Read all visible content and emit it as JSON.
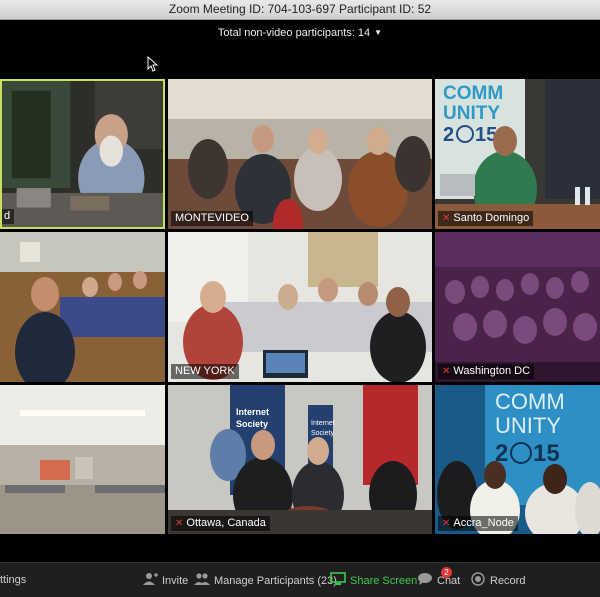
{
  "window": {
    "title": "Zoom Meeting ID: 704-103-697  Participant ID: 52"
  },
  "banner": {
    "text": "Total non-video participants: 14"
  },
  "tiles": [
    {
      "label": "d",
      "muted": false
    },
    {
      "label": "MONTEVIDEO",
      "muted": false
    },
    {
      "label": "Santo Domingo",
      "muted": true
    },
    {
      "label": "",
      "muted": false
    },
    {
      "label": "NEW YORK",
      "muted": false
    },
    {
      "label": "Washington DC",
      "muted": true
    },
    {
      "label": "",
      "muted": false
    },
    {
      "label": "Ottawa, Canada",
      "muted": true
    },
    {
      "label": "Accra_Node",
      "muted": true
    }
  ],
  "posters": {
    "community_top": "COMM\nUNITY",
    "year_top": "2015",
    "community_bottom": "COMM\nUNITY",
    "year_bottom": "2015",
    "isoc_left": "Internet\nSociety",
    "isoc_right": "Internet\nSociety"
  },
  "toolbar": {
    "settings": "ttings",
    "invite": "Invite",
    "manage": "Manage Participants (23)",
    "share": "Share Screen",
    "chat": "Chat",
    "chat_badge": "2",
    "record": "Record"
  },
  "colors": {
    "active_border": "#c8e05a",
    "share_green": "#3cc94c",
    "muted_red": "#e23b3b"
  }
}
